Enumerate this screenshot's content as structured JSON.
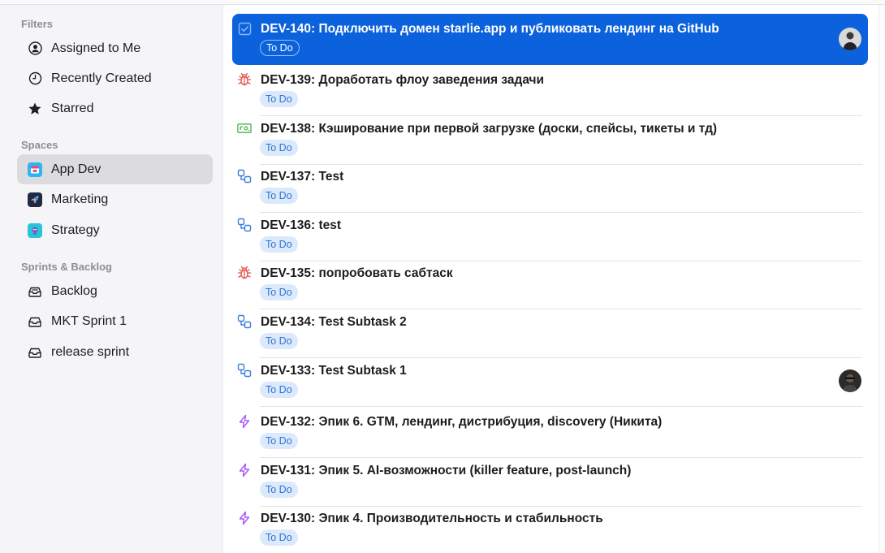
{
  "sidebar": {
    "filters_title": "Filters",
    "filters": [
      {
        "label": "Assigned to Me",
        "icon": "person-circle-icon"
      },
      {
        "label": "Recently Created",
        "icon": "clock-icon"
      },
      {
        "label": "Starred",
        "icon": "star-icon"
      }
    ],
    "spaces_title": "Spaces",
    "spaces": [
      {
        "label": "App Dev",
        "icon": "app-dev-space-icon",
        "color": "#29b6f6",
        "active": true
      },
      {
        "label": "Marketing",
        "icon": "rocket-icon",
        "color": "#1e2a44",
        "active": false
      },
      {
        "label": "Strategy",
        "icon": "strategy-space-icon",
        "color": "#26c6da",
        "active": false
      }
    ],
    "sprints_title": "Sprints & Backlog",
    "sprints": [
      {
        "label": "Backlog",
        "icon": "backlog-tray-icon"
      },
      {
        "label": "MKT Sprint 1",
        "icon": "tray-icon"
      },
      {
        "label": "release sprint",
        "icon": "tray-icon"
      }
    ]
  },
  "tasks": [
    {
      "title": "DEV-140: Подключить домен starlie.app и публиковать лендинг на GitHub",
      "status": "To Do",
      "type": "task",
      "selected": true,
      "avatar": true
    },
    {
      "title": "DEV-139: Доработать флоу заведения задачи",
      "status": "To Do",
      "type": "bug"
    },
    {
      "title": "DEV-138: Кэширование при первой загрузке (доски, спейсы, тикеты и тд)",
      "status": "To Do",
      "type": "story"
    },
    {
      "title": "DEV-137: Test",
      "status": "To Do",
      "type": "subtask"
    },
    {
      "title": "DEV-136: test",
      "status": "To Do",
      "type": "subtask"
    },
    {
      "title": "DEV-135: попробовать сабтаск",
      "status": "To Do",
      "type": "bug"
    },
    {
      "title": "DEV-134: Test Subtask 2",
      "status": "To Do",
      "type": "subtask"
    },
    {
      "title": "DEV-133: Test Subtask 1",
      "status": "To Do",
      "type": "subtask",
      "avatar": true
    },
    {
      "title": "DEV-132: Эпик 6. GTM, лендинг, дистрибуция, discovery (Никита)",
      "status": "To Do",
      "type": "epic"
    },
    {
      "title": "DEV-131: Эпик 5. AI-возможности (killer feature, post-launch)",
      "status": "To Do",
      "type": "epic"
    },
    {
      "title": "DEV-130: Эпик 4. Производительность и стабильность",
      "status": "To Do",
      "type": "epic"
    }
  ],
  "colors": {
    "selected": "#0b62dc",
    "status_bg": "#dbe9fb",
    "status_text": "#2f74d6",
    "bug": "#e5534b",
    "story": "#4caf50",
    "subtask": "#3b7ddd",
    "epic": "#a855f7"
  }
}
